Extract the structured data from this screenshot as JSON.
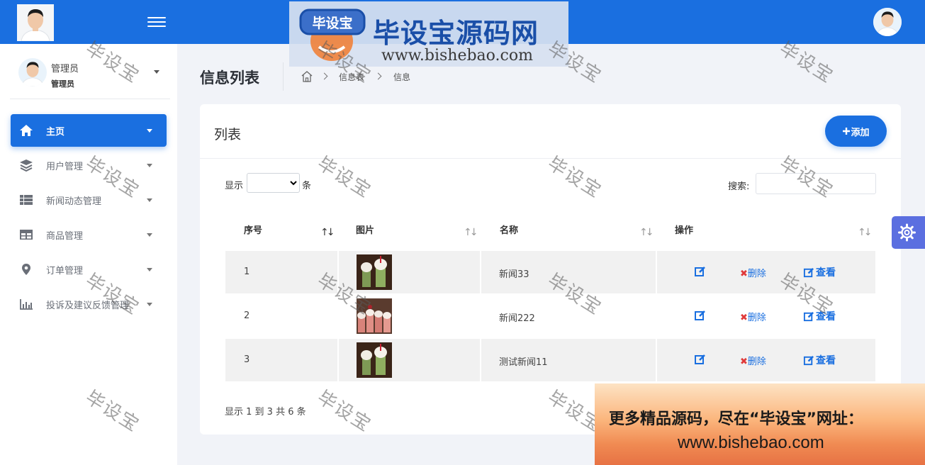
{
  "header": {
    "logo_icon": "user-photo",
    "menu_icon": "hamburger-icon",
    "profile_icon": "user-photo"
  },
  "watermark_logo": {
    "badge_text": "毕设宝",
    "title": "毕设宝源码网",
    "url": "www.bishebao.com"
  },
  "sidebar": {
    "user": {
      "name": "管理员",
      "role": "管理员"
    },
    "items": [
      {
        "label": "主页",
        "icon": "home-icon",
        "active": true
      },
      {
        "label": "用户管理",
        "icon": "layers-icon",
        "active": false
      },
      {
        "label": "新闻动态管理",
        "icon": "list-icon",
        "active": false
      },
      {
        "label": "商品管理",
        "icon": "grid-icon",
        "active": false
      },
      {
        "label": "订单管理",
        "icon": "location-pin-icon",
        "active": false
      },
      {
        "label": "投诉及建议反馈管理",
        "icon": "bar-chart-icon",
        "active": false
      }
    ]
  },
  "page": {
    "title": "信息列表",
    "breadcrumb": [
      "信息表",
      "信息"
    ]
  },
  "card": {
    "title": "列表",
    "add_label": "添加",
    "show_label": "显示",
    "show_unit": "条",
    "show_value": "",
    "search_label": "搜索:",
    "search_value": "",
    "columns": [
      "序号",
      "图片",
      "名称",
      "操作"
    ],
    "rows": [
      {
        "idx": "1",
        "name": "新闻33",
        "delete_label": "删除",
        "view_label": "查看"
      },
      {
        "idx": "2",
        "name": "新闻222",
        "delete_label": "删除",
        "view_label": "查看"
      },
      {
        "idx": "3",
        "name": "测试新闻11",
        "delete_label": "删除",
        "view_label": "查看"
      }
    ],
    "footer": "显示 1 到 3 共 6 条"
  },
  "watermark_text": "毕设宝",
  "promo": {
    "line1": "更多精品源码，尽在“毕设宝”网址：",
    "line2": "www.bishebao.com"
  },
  "colors": {
    "primary": "#1a6fe0",
    "settings": "#5b6fe0",
    "danger": "#e03a3a"
  }
}
